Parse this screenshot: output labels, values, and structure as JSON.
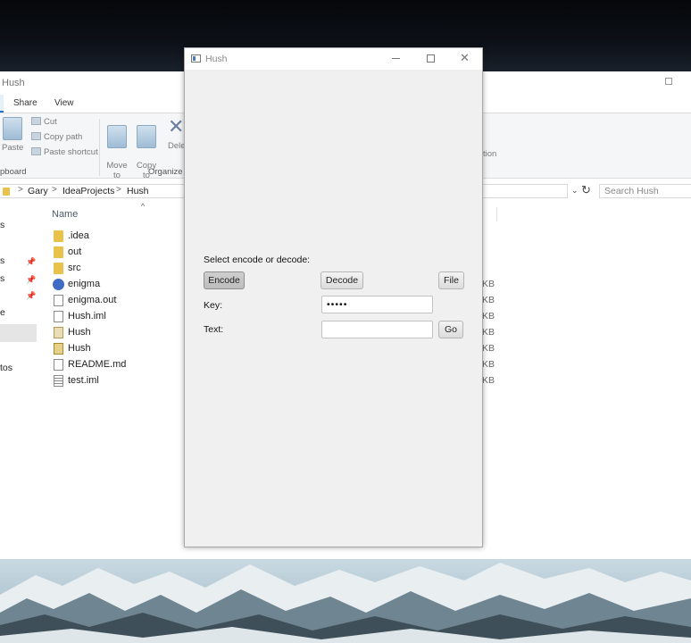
{
  "explorer": {
    "title": "Hush",
    "ribbon_tabs": [
      "Share",
      "View"
    ],
    "clipboard": {
      "paste_label": "Paste",
      "cut_label": "Cut",
      "copy_path_label": "Copy path",
      "paste_shortcut_label": "Paste shortcut",
      "group_label": "pboard"
    },
    "organize": {
      "move_to_label": "Move\nto",
      "copy_to_label": "Copy\nto",
      "delete_label": "Dele",
      "group_label": "Organize",
      "partial_label": "tion"
    },
    "breadcrumb": [
      "Gary",
      "IdeaProjects",
      "Hush"
    ],
    "search_placeholder": "Search Hush",
    "nav_items": [
      {
        "label": "s",
        "pinned": false
      },
      {
        "label": "s",
        "pinned": true
      },
      {
        "label": "s",
        "pinned": true
      },
      {
        "label": "e",
        "pinned": false
      },
      {
        "label": "tos",
        "pinned": false
      }
    ],
    "column_name": "Name",
    "files": [
      {
        "name": ".idea",
        "type": "folder",
        "size": ""
      },
      {
        "name": "out",
        "type": "folder",
        "size": ""
      },
      {
        "name": "src",
        "type": "folder",
        "size": ""
      },
      {
        "name": "enigma",
        "type": "cpp",
        "size": "KB"
      },
      {
        "name": "enigma.out",
        "type": "doc",
        "size": "KB"
      },
      {
        "name": "Hush.iml",
        "type": "doc",
        "size": "KB"
      },
      {
        "name": "Hush",
        "type": "java",
        "size": "KB"
      },
      {
        "name": "Hush",
        "type": "jar",
        "size": "KB"
      },
      {
        "name": "README.md",
        "type": "doc",
        "size": "KB"
      },
      {
        "name": "test.iml",
        "type": "lines",
        "size": "KB"
      }
    ]
  },
  "hush": {
    "title": "Hush",
    "prompt": "Select encode or decode:",
    "encode_label": "Encode",
    "decode_label": "Decode",
    "file_label": "File",
    "key_label": "Key:",
    "key_value": "•••••",
    "text_label": "Text:",
    "text_value": "",
    "go_label": "Go",
    "selected_mode": "Encode"
  },
  "icons": {
    "explorer_max": "maximize-icon",
    "refresh": "refresh-icon",
    "pin": "pin-icon",
    "sort": "sort-up-icon"
  },
  "colors": {
    "selection_blue": "#1a73c8",
    "window_bg": "#f0f0f0",
    "folder_yellow": "#e8c24a"
  }
}
